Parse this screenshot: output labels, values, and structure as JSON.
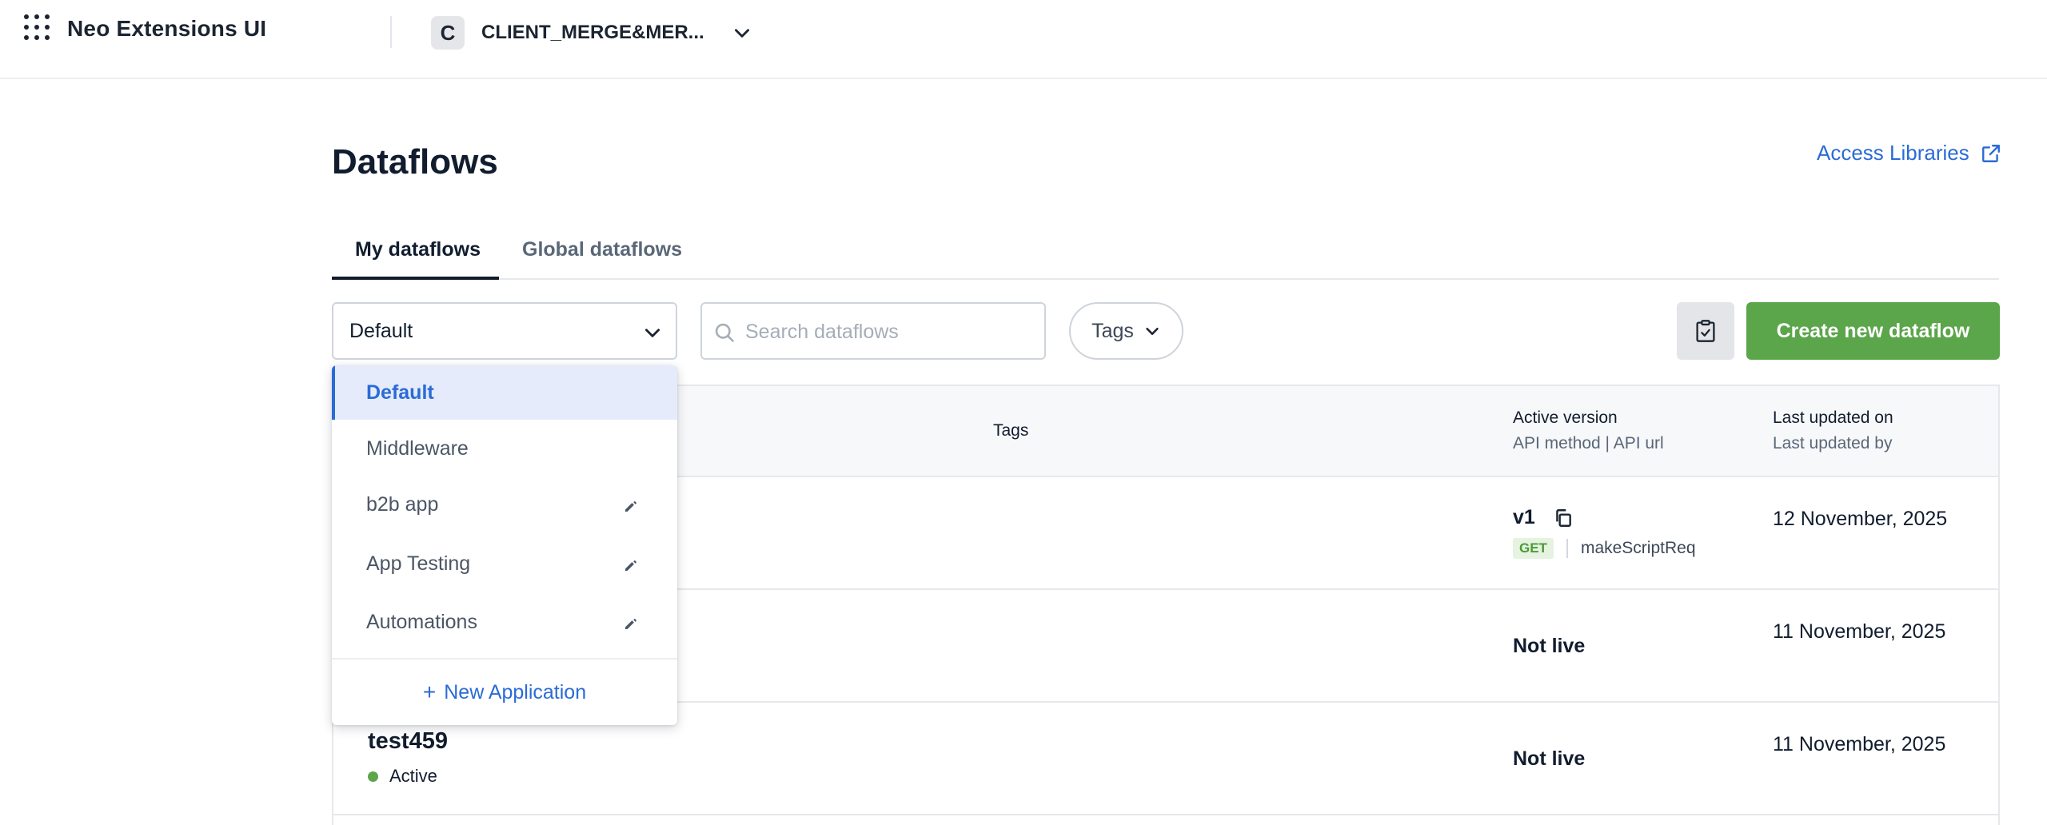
{
  "header": {
    "app_title": "Neo Extensions UI",
    "client_initial": "C",
    "client_name": "CLIENT_MERGE&MER..."
  },
  "page": {
    "title": "Dataflows",
    "access_libraries": "Access Libraries"
  },
  "tabs": [
    {
      "label": "My dataflows",
      "active": true
    },
    {
      "label": "Global dataflows",
      "active": false
    }
  ],
  "toolbar": {
    "application_select_value": "Default",
    "search_placeholder": "Search dataflows",
    "tags_label": "Tags",
    "create_label": "Create new dataflow"
  },
  "table": {
    "headers": {
      "tags": "Tags",
      "active_version": "Active version",
      "active_version_sub": "API method | API url",
      "last_updated": "Last updated on",
      "last_updated_sub": "Last updated by"
    },
    "rows": [
      {
        "version": "v1",
        "method": "GET",
        "api_url": "makeScriptReq",
        "updated_on": "12 November, 2025"
      },
      {
        "live_status": "Not live",
        "updated_on": "11 November, 2025"
      },
      {
        "name": "test459",
        "status": "Active",
        "live_status": "Not live",
        "updated_on": "11 November, 2025"
      }
    ]
  },
  "dropdown": {
    "items": [
      {
        "label": "Default",
        "selected": true,
        "editable": false
      },
      {
        "label": "Middleware",
        "selected": false,
        "editable": false
      },
      {
        "label": "b2b app",
        "selected": false,
        "editable": true
      },
      {
        "label": "App Testing",
        "selected": false,
        "editable": true
      },
      {
        "label": "Automations",
        "selected": false,
        "editable": true
      }
    ],
    "new_application": "New Application"
  },
  "colors": {
    "accent_blue": "#2a6bd6",
    "create_green": "#5ba54a",
    "status_active": "#5ba54a",
    "get_badge_bg": "#e5f3e0"
  },
  "icons": [
    "apps-grid-icon",
    "chevron-down-icon",
    "external-link-icon",
    "search-icon",
    "clipboard-check-icon",
    "copy-icon",
    "pencil-icon",
    "plus-icon"
  ]
}
